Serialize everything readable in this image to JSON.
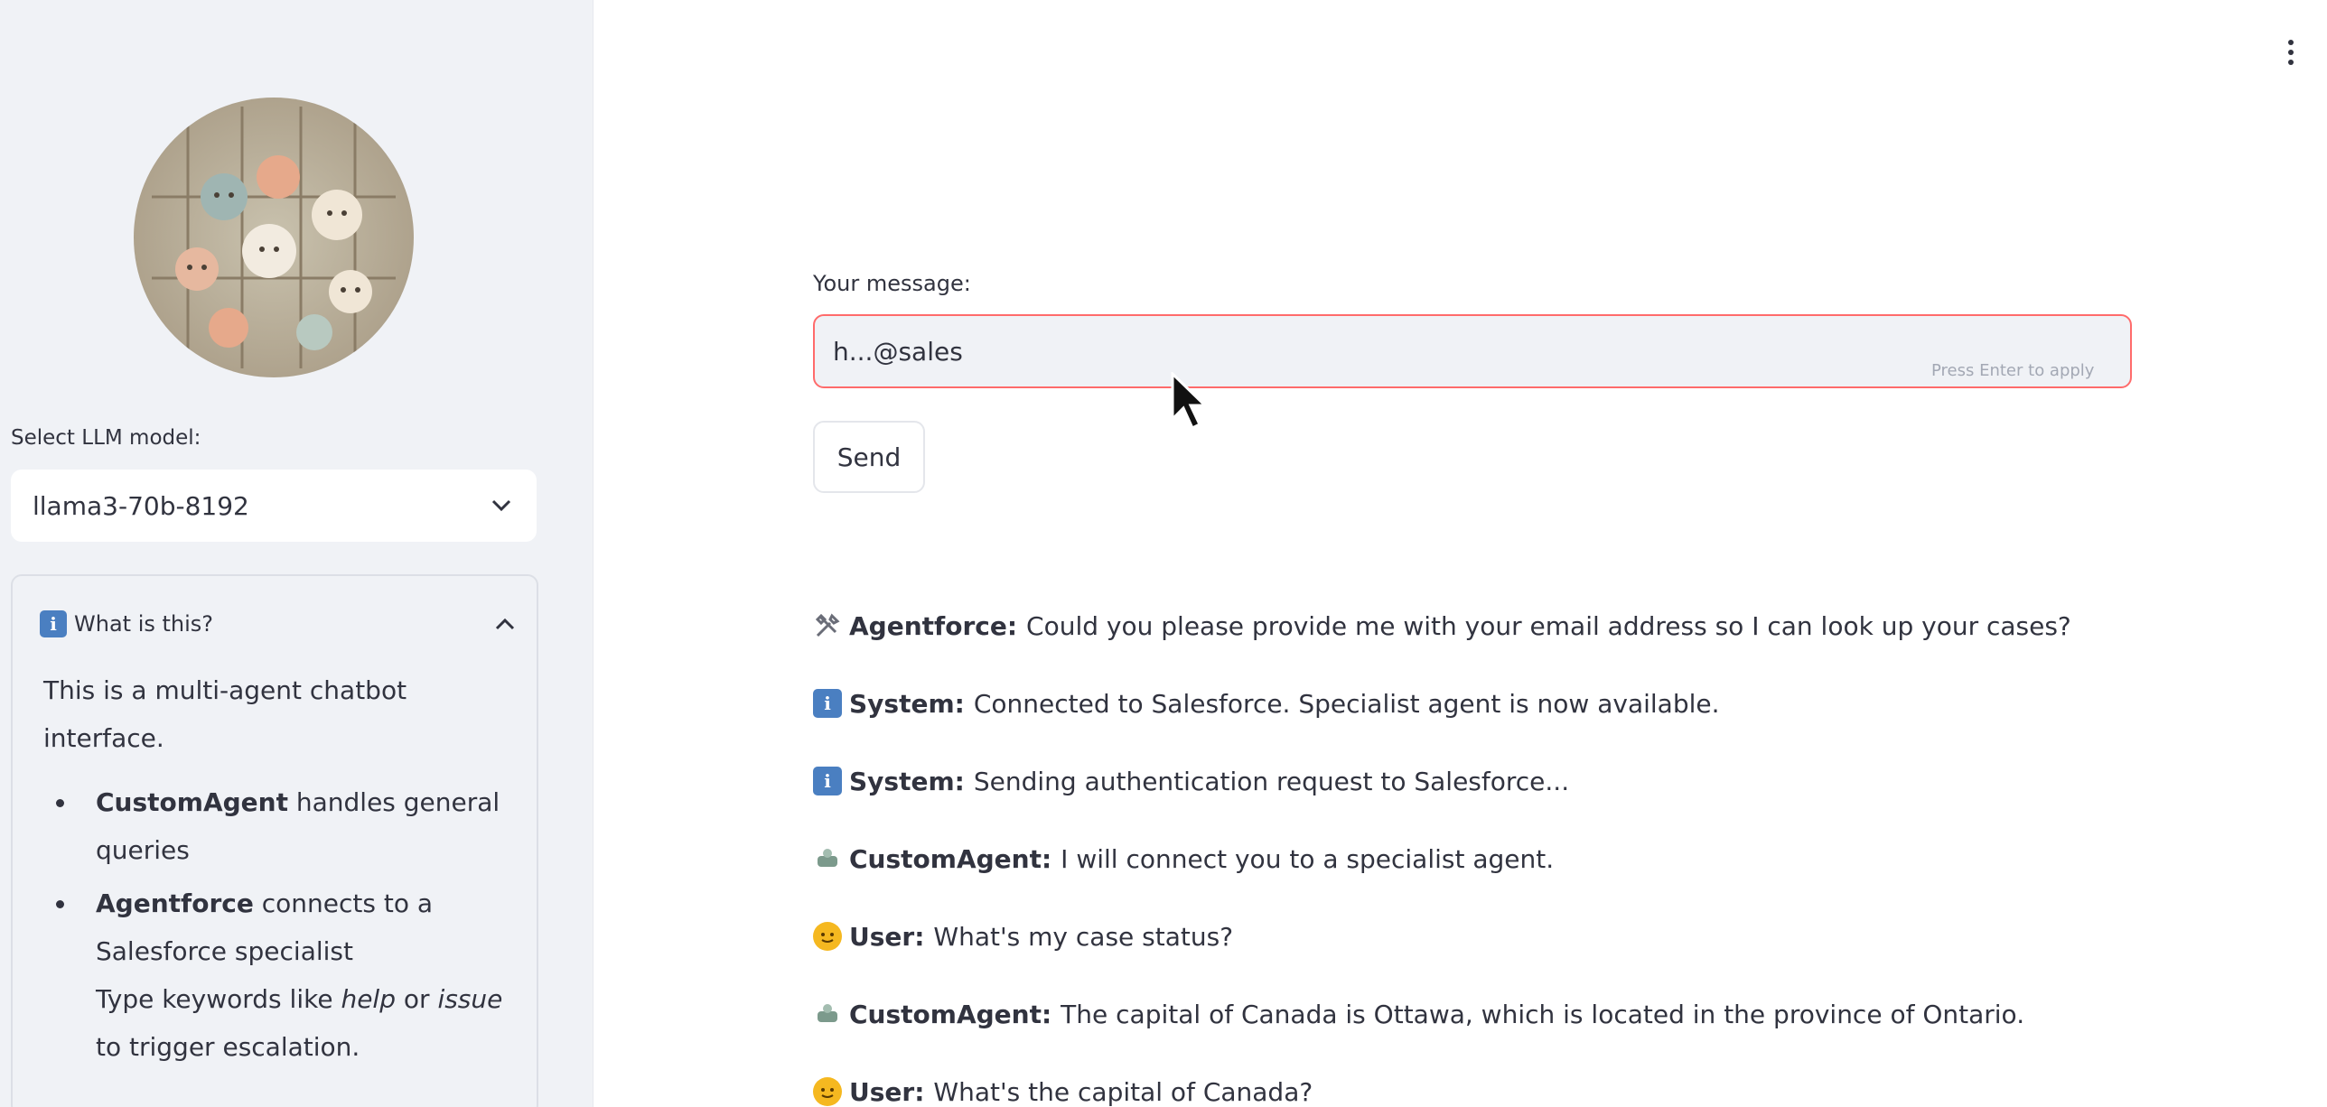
{
  "sidebar": {
    "model_label": "Select LLM model:",
    "model_selected": "llama3-70b-8192",
    "expander": {
      "title": "What is this?",
      "intro": "This is a multi-agent chatbot interface.",
      "bullet1": {
        "bold": "CustomAgent",
        "text": " handles general queries"
      },
      "bullet2": {
        "bold": "Agentforce",
        "text": " connects to a Salesforce specialist",
        "line2_pre": "Type keywords like ",
        "kw1": "help",
        "mid": " or ",
        "kw2": "issue",
        "line2_post": " to trigger escalation."
      }
    }
  },
  "main": {
    "message_label": "Your message:",
    "message_value": "h...@sales",
    "input_hint": "Press Enter to apply",
    "send_label": "Send",
    "chat": [
      {
        "icon": "tools-icon",
        "speaker": "Agentforce:",
        "text": "Could you please provide me with your email address so I can look up your cases?"
      },
      {
        "icon": "info-icon",
        "speaker": "System:",
        "text": "Connected to Salesforce. Specialist agent is now available."
      },
      {
        "icon": "info-icon",
        "speaker": "System:",
        "text": "Sending authentication request to Salesforce..."
      },
      {
        "icon": "robot-icon",
        "speaker": "CustomAgent:",
        "text": "I will connect you to a specialist agent."
      },
      {
        "icon": "user-face-icon",
        "speaker": "User:",
        "text": "What's my case status?"
      },
      {
        "icon": "robot-icon",
        "speaker": "CustomAgent:",
        "text": "The capital of Canada is Ottawa, which is located in the province of Ontario."
      },
      {
        "icon": "user-face-icon",
        "speaker": "User:",
        "text": "What's the capital of Canada?"
      }
    ]
  },
  "colors": {
    "sidebar_bg": "#f0f2f6",
    "input_border_focus": "#ff6b6b",
    "info_icon": "#4a7fc1",
    "text": "#31333f"
  }
}
